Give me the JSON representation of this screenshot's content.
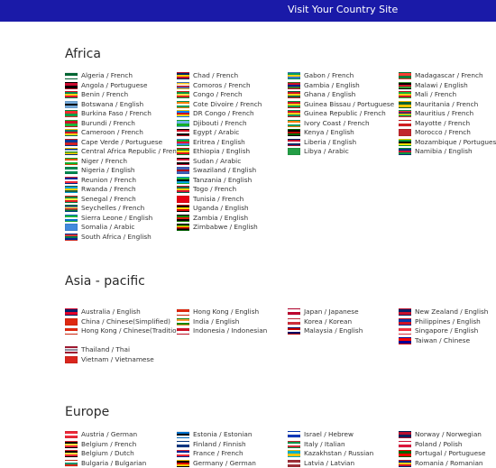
{
  "header": {
    "title": "Visit Your Country Site",
    "bg_color": "#1a1aa8"
  },
  "regions": [
    {
      "name": "Africa",
      "columns": [
        [
          {
            "label": "Algeria / French",
            "flag": "algeria-flag",
            "c": [
              "#006633",
              "#ffffff"
            ]
          },
          {
            "label": "Angola / Portuguese",
            "flag": "angola-flag",
            "c": [
              "#cc092f",
              "#000000"
            ]
          },
          {
            "label": "Benin / French",
            "flag": "benin-flag",
            "c": [
              "#008751",
              "#fcd116",
              "#e8112d"
            ]
          },
          {
            "label": "Botswana / English",
            "flag": "botswana-flag",
            "c": [
              "#75aadb",
              "#000000",
              "#75aadb"
            ]
          },
          {
            "label": "Burkina Faso / French",
            "flag": "burkina-faso-flag",
            "c": [
              "#ef2b2d",
              "#009e49"
            ]
          },
          {
            "label": "Burundi / French",
            "flag": "burundi-flag",
            "c": [
              "#ce1126",
              "#1eb53a"
            ]
          },
          {
            "label": "Cameroon / French",
            "flag": "cameroon-flag",
            "c": [
              "#007a5e",
              "#ce1126",
              "#fcd116"
            ]
          },
          {
            "label": "Cape Verde / Portuguese",
            "flag": "cape-verde-flag",
            "c": [
              "#003893",
              "#cf2027"
            ]
          },
          {
            "label": "Central Africa Republic / French",
            "flag": "central-african-republic-flag",
            "c": [
              "#003082",
              "#ffffff",
              "#289728",
              "#ffce00"
            ]
          },
          {
            "label": "Niger / French",
            "flag": "niger-flag",
            "c": [
              "#e05206",
              "#ffffff",
              "#0db02b"
            ]
          },
          {
            "label": "Nigeria / English",
            "flag": "nigeria-flag",
            "c": [
              "#008751",
              "#ffffff",
              "#008751"
            ]
          },
          {
            "label": "Reunion / French",
            "flag": "reunion-flag",
            "c": [
              "#002395",
              "#ffffff",
              "#ed2939"
            ]
          },
          {
            "label": "Rwanda / French",
            "flag": "rwanda-flag",
            "c": [
              "#00a1de",
              "#fad201",
              "#20603d"
            ]
          },
          {
            "label": "Senegal / French",
            "flag": "senegal-flag",
            "c": [
              "#00853f",
              "#fdef42",
              "#e31b23"
            ]
          },
          {
            "label": "Seychelles / French",
            "flag": "seychelles-flag",
            "c": [
              "#003f87",
              "#fcd856",
              "#d62828",
              "#007a3d"
            ]
          },
          {
            "label": "Sierra Leone / English",
            "flag": "sierra-leone-flag",
            "c": [
              "#1eb53a",
              "#ffffff",
              "#0072c6"
            ]
          },
          {
            "label": "Somalia / Arabic",
            "flag": "somalia-flag",
            "c": [
              "#4189dd"
            ]
          },
          {
            "label": "South Africa / English",
            "flag": "south-africa-flag",
            "c": [
              "#de3831",
              "#007a4d",
              "#002395"
            ]
          }
        ],
        [
          {
            "label": "Chad / French",
            "flag": "chad-flag",
            "c": [
              "#002664",
              "#fecb00",
              "#c60c30"
            ]
          },
          {
            "label": "Comoros / French",
            "flag": "comoros-flag",
            "c": [
              "#ffc61e",
              "#ffffff",
              "#ce1126",
              "#3a75c4"
            ]
          },
          {
            "label": "Congo / French",
            "flag": "congo-flag",
            "c": [
              "#009543",
              "#fbde4a",
              "#dc241f"
            ]
          },
          {
            "label": "Cote Divoire / French",
            "flag": "cote-divoire-flag",
            "c": [
              "#f77f00",
              "#ffffff",
              "#009e60"
            ]
          },
          {
            "label": "DR Congo / French",
            "flag": "dr-congo-flag",
            "c": [
              "#007fff",
              "#ce1021",
              "#f7d618"
            ]
          },
          {
            "label": "Djibouti / French",
            "flag": "djibouti-flag",
            "c": [
              "#6ab2e7",
              "#12ad2b"
            ]
          },
          {
            "label": "Egypt / Arabic",
            "flag": "egypt-flag",
            "c": [
              "#ce1126",
              "#ffffff",
              "#000000"
            ]
          },
          {
            "label": "Eritrea / English",
            "flag": "eritrea-flag",
            "c": [
              "#12ad2b",
              "#ea0437",
              "#4189dd"
            ]
          },
          {
            "label": "Ethiopia / English",
            "flag": "ethiopia-flag",
            "c": [
              "#078930",
              "#fcdd09",
              "#da121a"
            ]
          },
          {
            "label": "Sudan / Arabic",
            "flag": "sudan-flag",
            "c": [
              "#d21034",
              "#ffffff",
              "#000000"
            ]
          },
          {
            "label": "Swaziland / English",
            "flag": "swaziland-flag",
            "c": [
              "#3e5eb9",
              "#b10c0c",
              "#3e5eb9"
            ]
          },
          {
            "label": "Tanzania / English",
            "flag": "tanzania-flag",
            "c": [
              "#1eb53a",
              "#000000",
              "#00a3dd"
            ]
          },
          {
            "label": "Togo / French",
            "flag": "togo-flag",
            "c": [
              "#006a4e",
              "#ffce00",
              "#d21034"
            ]
          },
          {
            "label": "Tunisia / French",
            "flag": "tunisia-flag",
            "c": [
              "#e70013"
            ]
          },
          {
            "label": "Uganda / English",
            "flag": "uganda-flag",
            "c": [
              "#000000",
              "#fcdc04",
              "#d90000"
            ]
          },
          {
            "label": "Zambia / English",
            "flag": "zambia-flag",
            "c": [
              "#198a00",
              "#de2010",
              "#000000"
            ]
          },
          {
            "label": "Zimbabwe / English",
            "flag": "zimbabwe-flag",
            "c": [
              "#006400",
              "#ffd200",
              "#d40000",
              "#000000"
            ]
          }
        ],
        [
          {
            "label": "Gabon / French",
            "flag": "gabon-flag",
            "c": [
              "#009e60",
              "#fcd116",
              "#3a75c4"
            ]
          },
          {
            "label": "Gambia / English",
            "flag": "gambia-flag",
            "c": [
              "#ce1126",
              "#0c1c8c",
              "#3a7728"
            ]
          },
          {
            "label": "Ghana / English",
            "flag": "ghana-flag",
            "c": [
              "#ce1126",
              "#fcd116",
              "#006b3f"
            ]
          },
          {
            "label": "Guinea Bissau / Portuguese",
            "flag": "guinea-bissau-flag",
            "c": [
              "#ce1126",
              "#fcd116",
              "#009e49"
            ]
          },
          {
            "label": "Guinea Republic / French",
            "flag": "guinea-flag",
            "c": [
              "#ce1126",
              "#fcd116",
              "#009460"
            ]
          },
          {
            "label": "Ivory Coast / French",
            "flag": "ivory-coast-flag",
            "c": [
              "#f77f00",
              "#ffffff",
              "#009e60"
            ]
          },
          {
            "label": "Kenya / English",
            "flag": "kenya-flag",
            "c": [
              "#000000",
              "#bb0000",
              "#006600"
            ]
          },
          {
            "label": "Liberia / English",
            "flag": "liberia-flag",
            "c": [
              "#bf0a30",
              "#ffffff",
              "#002868"
            ]
          },
          {
            "label": "Libya / Arabic",
            "flag": "libya-flag",
            "c": [
              "#239e46"
            ]
          }
        ],
        [
          {
            "label": "Madagascar / French",
            "flag": "madagascar-flag",
            "c": [
              "#fc3d32",
              "#007e3a"
            ]
          },
          {
            "label": "Malawi / English",
            "flag": "malawi-flag",
            "c": [
              "#000000",
              "#ce1126",
              "#339e35"
            ]
          },
          {
            "label": "Mali / French",
            "flag": "mali-flag",
            "c": [
              "#14b53a",
              "#fcd116",
              "#ce1126"
            ]
          },
          {
            "label": "Mauritania / French",
            "flag": "mauritania-flag",
            "c": [
              "#006233",
              "#ffc400"
            ]
          },
          {
            "label": "Mauritius / French",
            "flag": "mauritius-flag",
            "c": [
              "#ea2839",
              "#1a206d",
              "#ffd500",
              "#00a551"
            ]
          },
          {
            "label": "Mayotte / French",
            "flag": "mayotte-flag",
            "c": [
              "#ffffff",
              "#d01c1f"
            ]
          },
          {
            "label": "Morocco / French",
            "flag": "morocco-flag",
            "c": [
              "#c1272d"
            ]
          },
          {
            "label": "Mozambique / Portuguese",
            "flag": "mozambique-flag",
            "c": [
              "#009739",
              "#000000",
              "#fce100"
            ]
          },
          {
            "label": "Namibia / English",
            "flag": "namibia-flag",
            "c": [
              "#003580",
              "#d21034",
              "#009543"
            ]
          }
        ]
      ]
    },
    {
      "name": "Asia - pacific",
      "columns": [
        [
          {
            "label": "Australia / English",
            "flag": "australia-flag",
            "c": [
              "#012169",
              "#e4002b"
            ]
          },
          {
            "label": "China / Chinese(Simplified)",
            "flag": "china-flag",
            "c": [
              "#de2910"
            ]
          },
          {
            "label": "Hong Kong / Chinese(Traditional)",
            "flag": "hong-kong-flag",
            "c": [
              "#de2910",
              "#ffffff"
            ]
          },
          {
            "label": "",
            "flag": "",
            "c": []
          },
          {
            "label": "Thailand / Thai",
            "flag": "thailand-flag",
            "c": [
              "#a51931",
              "#f4f5f8",
              "#2d2a4a",
              "#f4f5f8",
              "#a51931"
            ]
          },
          {
            "label": "Vietnam / Vietnamese",
            "flag": "vietnam-flag",
            "c": [
              "#da251d"
            ]
          }
        ],
        [
          {
            "label": "Hong Kong / English",
            "flag": "hong-kong-flag",
            "c": [
              "#de2910",
              "#ffffff"
            ]
          },
          {
            "label": "India / English",
            "flag": "india-flag",
            "c": [
              "#ff9933",
              "#ffffff",
              "#138808"
            ]
          },
          {
            "label": "Indonesia / Indonesian",
            "flag": "indonesia-flag",
            "c": [
              "#ce1126",
              "#ffffff"
            ]
          }
        ],
        [
          {
            "label": "Japan / Japanese",
            "flag": "japan-flag",
            "c": [
              "#ffffff",
              "#bc002d"
            ]
          },
          {
            "label": "Korea / Korean",
            "flag": "korea-flag",
            "c": [
              "#ffffff",
              "#cd2e3a"
            ]
          },
          {
            "label": "Malaysia / English",
            "flag": "malaysia-flag",
            "c": [
              "#cc0001",
              "#ffffff",
              "#010066"
            ]
          }
        ],
        [
          {
            "label": "New Zealand / English",
            "flag": "new-zealand-flag",
            "c": [
              "#012169",
              "#c8102e"
            ]
          },
          {
            "label": "Philippines / English",
            "flag": "philippines-flag",
            "c": [
              "#0038a8",
              "#ce1126"
            ]
          },
          {
            "label": "Singapore / English",
            "flag": "singapore-flag",
            "c": [
              "#ef3340",
              "#ffffff"
            ]
          },
          {
            "label": "Taiwan / Chinese",
            "flag": "taiwan-flag",
            "c": [
              "#fe0000",
              "#000095"
            ]
          }
        ]
      ]
    },
    {
      "name": "Europe",
      "columns": [
        [
          {
            "label": "Austria / German",
            "flag": "austria-flag",
            "c": [
              "#ed2939",
              "#ffffff",
              "#ed2939"
            ]
          },
          {
            "label": "Belgium / French",
            "flag": "belgium-flag",
            "c": [
              "#000000",
              "#fae042",
              "#ed2939"
            ]
          },
          {
            "label": "Belgium / Dutch",
            "flag": "belgium-flag",
            "c": [
              "#000000",
              "#fae042",
              "#ed2939"
            ]
          },
          {
            "label": "Bulgaria / Bulgarian",
            "flag": "bulgaria-flag",
            "c": [
              "#ffffff",
              "#00966e",
              "#d62612"
            ]
          }
        ],
        [
          {
            "label": "Estonia / Estonian",
            "flag": "estonia-flag",
            "c": [
              "#0072ce",
              "#000000",
              "#ffffff"
            ]
          },
          {
            "label": "Finland / Finnish",
            "flag": "finland-flag",
            "c": [
              "#ffffff",
              "#003580"
            ]
          },
          {
            "label": "France / French",
            "flag": "france-flag",
            "c": [
              "#002395",
              "#ffffff",
              "#ed2939"
            ]
          },
          {
            "label": "Germany / German",
            "flag": "germany-flag",
            "c": [
              "#000000",
              "#dd0000",
              "#ffce00"
            ]
          }
        ],
        [
          {
            "label": "Israel / Hebrew",
            "flag": "israel-flag",
            "c": [
              "#ffffff",
              "#0038b8"
            ]
          },
          {
            "label": "Italy / Italian",
            "flag": "italy-flag",
            "c": [
              "#009246",
              "#ffffff",
              "#ce2b37"
            ]
          },
          {
            "label": "Kazakhstan / Russian",
            "flag": "kazakhstan-flag",
            "c": [
              "#00afca",
              "#fec50c"
            ]
          },
          {
            "label": "Latvia / Latvian",
            "flag": "latvia-flag",
            "c": [
              "#9e3039",
              "#ffffff",
              "#9e3039"
            ]
          }
        ],
        [
          {
            "label": "Norway / Norwegian",
            "flag": "norway-flag",
            "c": [
              "#ba0c2f",
              "#00205b"
            ]
          },
          {
            "label": "Poland / Polish",
            "flag": "poland-flag",
            "c": [
              "#ffffff",
              "#dc143c"
            ]
          },
          {
            "label": "Portugal / Portuguese",
            "flag": "portugal-flag",
            "c": [
              "#006600",
              "#ff0000"
            ]
          },
          {
            "label": "Romania / Romanian",
            "flag": "romania-flag",
            "c": [
              "#002b7f",
              "#fcd116",
              "#ce1126"
            ]
          }
        ]
      ]
    }
  ]
}
